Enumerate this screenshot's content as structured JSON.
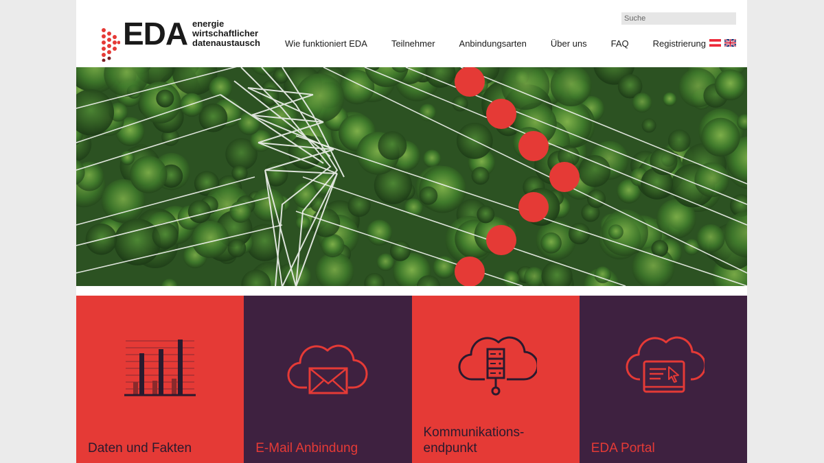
{
  "header": {
    "logo_word": "EDA",
    "logo_tagline": [
      "energie",
      "wirtschaftlicher",
      "datenaustausch"
    ],
    "search": {
      "placeholder": "Suche",
      "value": ""
    }
  },
  "nav": {
    "items": [
      {
        "label": "Wie funktioniert EDA"
      },
      {
        "label": "Teilnehmer"
      },
      {
        "label": "Anbindungsarten"
      },
      {
        "label": "Über uns"
      },
      {
        "label": "FAQ"
      },
      {
        "label": "Registrierung"
      }
    ],
    "languages": [
      "de",
      "en"
    ]
  },
  "hero": {
    "image": "aerial view of electricity pylon and power lines over forest",
    "dot_color": "#e53a36"
  },
  "tiles": [
    {
      "label_lines": [
        "Daten und Fakten"
      ],
      "icon": "bar-chart-icon",
      "bg": "#e53a36"
    },
    {
      "label_lines": [
        "E-Mail Anbindung"
      ],
      "icon": "cloud-mail-icon",
      "bg": "#3e2140"
    },
    {
      "label_lines": [
        "Kommunikations-",
        "endpunkt"
      ],
      "icon": "cloud-server-icon",
      "bg": "#e53a36"
    },
    {
      "label_lines": [
        "EDA Portal"
      ],
      "icon": "cloud-portal-icon",
      "bg": "#3e2140"
    }
  ],
  "colors": {
    "brand_red": "#e53a36",
    "brand_purple": "#3e2140"
  }
}
